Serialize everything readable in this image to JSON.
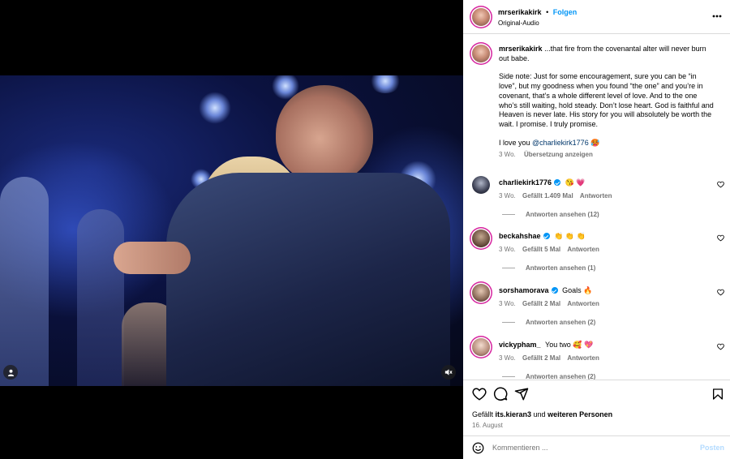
{
  "header": {
    "username": "mrserikakirk",
    "separator": "•",
    "follow_label": "Folgen",
    "audio_label": "Original-Audio",
    "more_icon": "more-horizontal-icon"
  },
  "caption": {
    "username": "mrserikakirk",
    "line1": "...that fire from the covenantal alter will never burn out babe.",
    "paragraph2": "Side note: Just for some encouragement, sure you can be “in love”, but my goodness when you found “the one” and you’re in covenant, that’s a whole different level of love. And to the one who’s still waiting, hold steady. Don’t lose heart. God is faithful and Heaven is never late. His story for you will absolutely be worth the wait. I promise. I truly promise.",
    "paragraph3_prefix": "I love you ",
    "mention": "@charliekirk1776",
    "paragraph3_suffix": " 🥵",
    "time": "3 Wo.",
    "translate_label": "Übersetzung anzeigen"
  },
  "comments": [
    {
      "username": "charliekirk1776",
      "verified": true,
      "text": "😘 💗",
      "time": "3 Wo.",
      "likes": "Gefällt 1.409 Mal",
      "reply_label": "Antworten",
      "view_replies": "Antworten ansehen (12)"
    },
    {
      "username": "beckahshae",
      "verified": true,
      "text": "👏 👏 👏",
      "time": "3 Wo.",
      "likes": "Gefällt 5 Mal",
      "reply_label": "Antworten",
      "view_replies": "Antworten ansehen (1)"
    },
    {
      "username": "sorshamorava",
      "verified": true,
      "text": "Goals 🔥",
      "time": "3 Wo.",
      "likes": "Gefällt 2 Mal",
      "reply_label": "Antworten",
      "view_replies": "Antworten ansehen (2)"
    },
    {
      "username": "vickypham_",
      "verified": false,
      "text": "You two 🥰 💖",
      "time": "3 Wo.",
      "likes": "Gefällt 2 Mal",
      "reply_label": "Antworten",
      "view_replies": "Antworten ansehen (2)"
    }
  ],
  "actions": {
    "icons": [
      "heart-icon",
      "comment-icon",
      "share-icon",
      "bookmark-icon"
    ],
    "likes_prefix": "Gefällt ",
    "liked_by": "its.kieran3",
    "likes_middle": " und ",
    "likes_suffix": "weiteren Personen",
    "date": "16. August"
  },
  "compose": {
    "placeholder": "Kommentieren ...",
    "post_label": "Posten"
  },
  "colors": {
    "accent": "#0095f6",
    "link": "#00376b",
    "muted": "#737373",
    "post_disabled": "#b3dbff",
    "heart": "#ed4956"
  }
}
